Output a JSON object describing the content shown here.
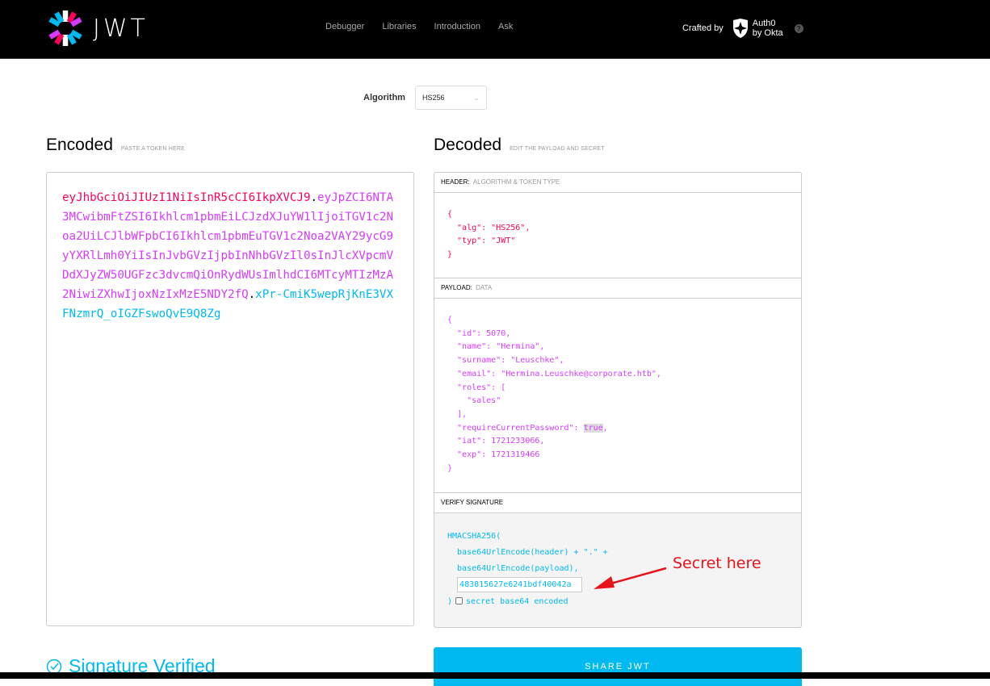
{
  "header": {
    "logo_text": "JWT",
    "nav": [
      "Debugger",
      "Libraries",
      "Introduction",
      "Ask"
    ],
    "crafted_by": "Crafted by",
    "brand_line1": "Auth0",
    "brand_line2": "by Okta",
    "help": "?"
  },
  "algorithm": {
    "label": "Algorithm",
    "selected": "HS256"
  },
  "encoded": {
    "title": "Encoded",
    "hint": "PASTE A TOKEN HERE",
    "token_header": "eyJhbGciOiJIUzI1NiIsInR5cCI6IkpXVCJ9",
    "token_payload": "eyJpZCI6NTA3MCwibmFtZSI6Ikhlcm1pbmEiLCJzdXJuYW1lIjoiTGV1c2Noa2UiLCJlbWFpbCI6Ikhlcm1pbmEuTGV1c2Noa2VAY29ycG9yYXRlLmh0YiIsInJvbGVzIjpbInNhbGVzIl0sInJlcXVpcmVDdXJyZW50UGFzc3dvcmQiOnRydWUsImlhdCI6MTcyMTIzMzA2NiwiZXhwIjoxNzIxMzE5NDY2fQ",
    "token_signature": "xPr-CmiK5wepRjKnE3VXFNzmrQ_oIGZFswoQvE9Q8Zg",
    "dot": "."
  },
  "decoded": {
    "title": "Decoded",
    "hint": "EDIT THE PAYLOAD AND SECRET",
    "header_panel": {
      "label": "HEADER:",
      "sub": "ALGORITHM & TOKEN TYPE",
      "json_lines": [
        "{",
        "  \"alg\": \"HS256\",",
        "  \"typ\": \"JWT\"",
        "}"
      ]
    },
    "payload_panel": {
      "label": "PAYLOAD:",
      "sub": "DATA",
      "json_before": "{\n  \"id\": 5070,\n  \"name\": \"Hermina\",\n  \"surname\": \"Leuschke\",\n  \"email\": \"Hermina.Leuschke@corporate.htb\",\n  \"roles\": [\n    \"sales\"\n  ],\n  \"requireCurrentPassword\": ",
      "highlighted": "true",
      "json_after": ",\n  \"iat\": 1721233066,\n  \"exp\": 1721319466\n}"
    },
    "signature_panel": {
      "label": "VERIFY SIGNATURE",
      "line1": "HMACSHA256(",
      "line2": "  base64UrlEncode(header) + \".\" +",
      "line3": "  base64UrlEncode(payload),",
      "secret_value": "483815627e6241bdf40042a",
      "close": ")",
      "checkbox_label": "secret base64 encoded"
    }
  },
  "annotation": {
    "text": "Secret here",
    "color": "#e8121b"
  },
  "footer": {
    "verified": "Signature Verified",
    "share_button": "SHARE JWT"
  },
  "colors": {
    "header_part": "#fb015b",
    "payload_part": "#d63aff",
    "signature_part": "#00b9f1"
  }
}
